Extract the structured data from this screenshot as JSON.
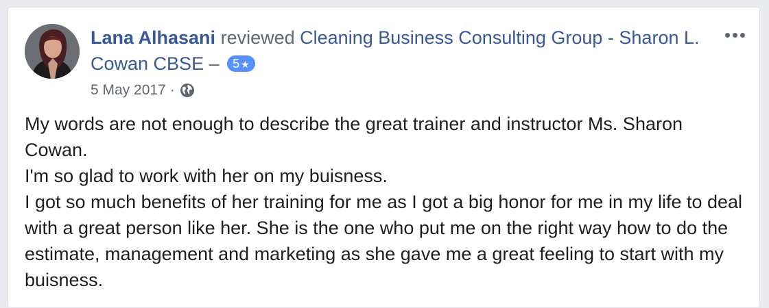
{
  "post": {
    "author": "Lana Alhasani",
    "action": "reviewed",
    "page_name": "Cleaning Business Consulting Group - Sharon L. Cowan CBSE",
    "dash": "–",
    "rating_value": "5",
    "rating_icon": "star-icon",
    "date": "5 May 2017",
    "separator": "·",
    "privacy_icon": "globe-icon",
    "more_icon": "more-options-icon",
    "paragraphs": [
      "My words are not enough to describe the great trainer and instructor Ms. Sharon Cowan.",
      "I'm so glad to work with her on my buisness.",
      "I got so much benefits of her training for me as I got a big honor for me in my life to deal with a great person like her. She is the one who put me on the right way how to do the estimate, management and marketing as she gave me a great feeling to start with my buisness."
    ]
  },
  "colors": {
    "link": "#385898",
    "meta_text": "#616770",
    "body_text": "#1c1e21",
    "rating_badge": "#5890ff",
    "card_bg": "#ffffff",
    "page_bg": "#e9ebee"
  }
}
